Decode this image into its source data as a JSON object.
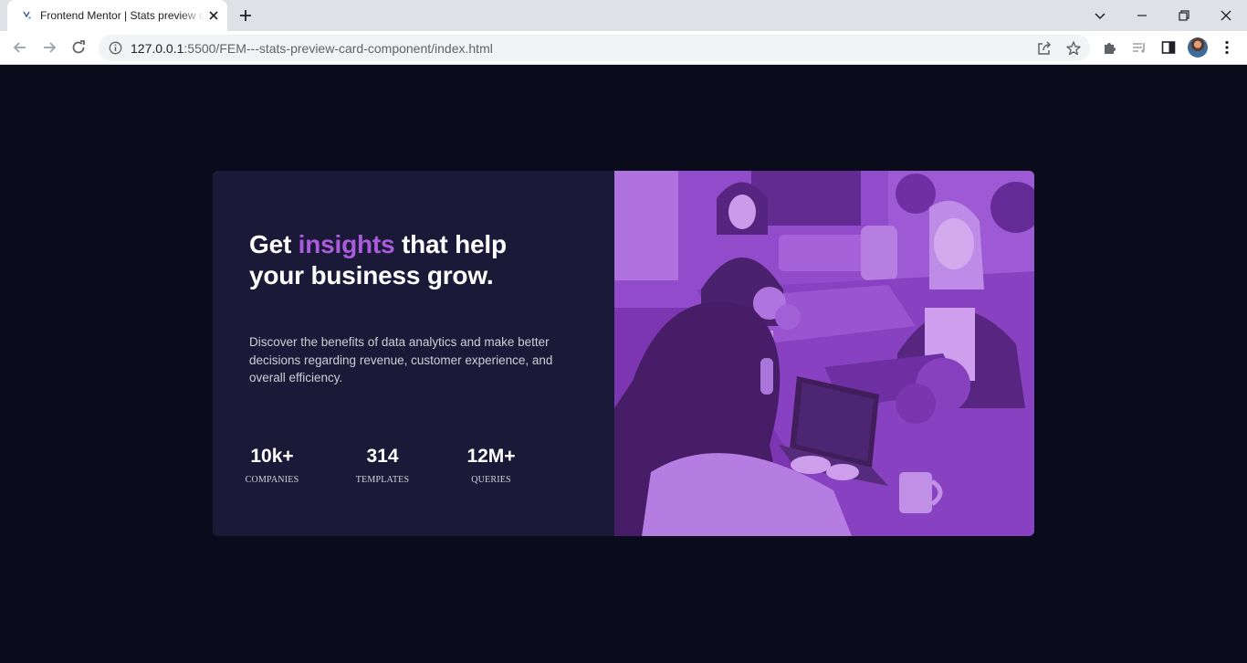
{
  "browser": {
    "tab_title": "Frontend Mentor | Stats preview card component",
    "url_host": "127.0.0.1",
    "url_rest": ":5500/FEM---stats-preview-card-component/index.html"
  },
  "card": {
    "headline_start": "Get ",
    "headline_accent": "insights",
    "headline_end": " that help your business grow.",
    "description": "Discover the benefits of data analytics and make better decisions regarding revenue, customer experience, and overall efficiency.",
    "stats": [
      {
        "value": "10k+",
        "label": "Companies"
      },
      {
        "value": "314",
        "label": "Templates"
      },
      {
        "value": "12M+",
        "label": "Queries"
      }
    ]
  },
  "colors": {
    "page_bg": "#0a0c1c",
    "card_bg": "#1b1938",
    "accent": "#aa5cdb",
    "image_tint": "#6f2aa8"
  }
}
